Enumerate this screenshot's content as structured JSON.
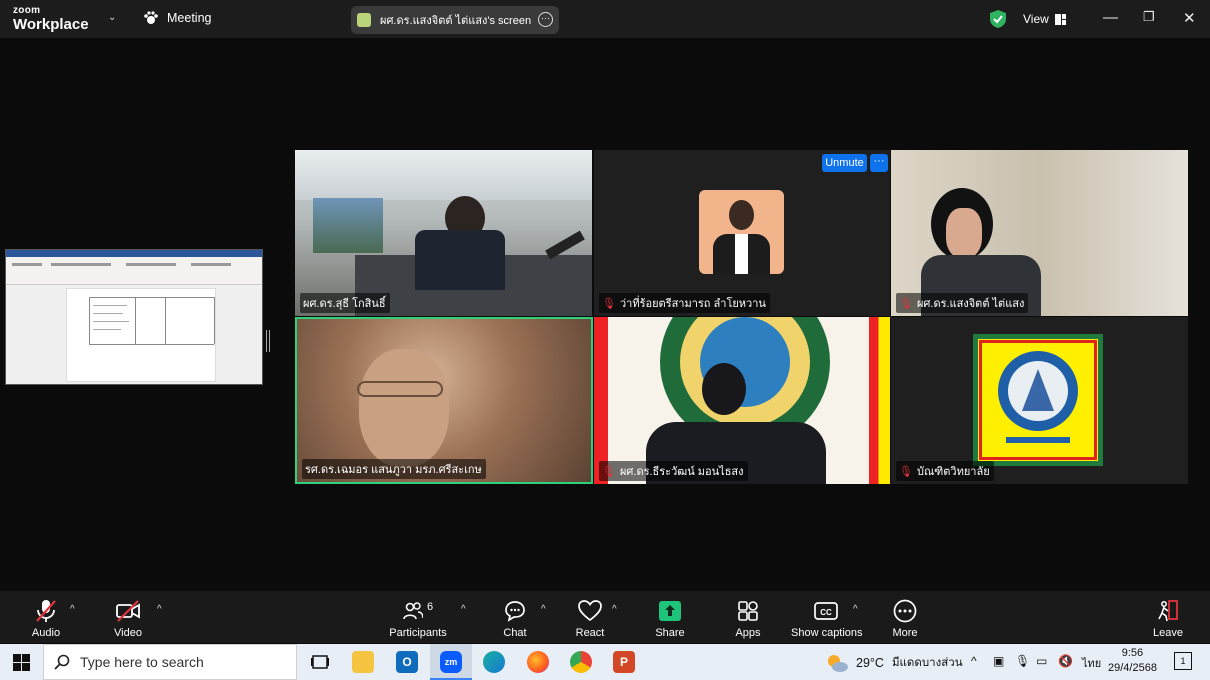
{
  "topbar": {
    "brand_line1": "zoom",
    "brand_line2": "Workplace",
    "meeting_label": "Meeting",
    "share_label": "ผศ.ดร.แสงจิตต์ ไต่แสง's screen",
    "view_label": "View"
  },
  "grid": {
    "unmute_label": "Unmute",
    "more_label": "···",
    "tiles": [
      {
        "name": "ผศ.ดร.สุธี โกสินธิ์",
        "muted": false
      },
      {
        "name": "ว่าที่ร้อยตรีสามารถ ลำโยหวาน",
        "muted": true
      },
      {
        "name": "ผศ.ดร.แสงจิตต์ ไต่แสง",
        "muted": true
      },
      {
        "name": "รศ.ดร.เฉมอร แสนภูวา มรภ.ศรีสะเกษ",
        "muted": false
      },
      {
        "name": "ผศ.ดร.ธีระวัฒน์ มอนไธสง",
        "muted": true
      },
      {
        "name": "บัณฑิตวิทยาลัย",
        "muted": true
      }
    ],
    "tile4_speaking_color": "#2ed17a"
  },
  "toolbar": {
    "audio": "Audio",
    "video": "Video",
    "participants": "Participants",
    "participants_count": "6",
    "chat": "Chat",
    "react": "React",
    "share": "Share",
    "apps": "Apps",
    "captions": "Show captions",
    "more": "More",
    "leave": "Leave",
    "share_color": "#1dc47a"
  },
  "taskbar": {
    "search_placeholder": "Type here to search",
    "weather_temp": "29°C",
    "weather_text": "มีแดดบางส่วน",
    "lang": "ไทย",
    "time": "9:56",
    "date": "29/4/2568",
    "notif_count": "1"
  }
}
